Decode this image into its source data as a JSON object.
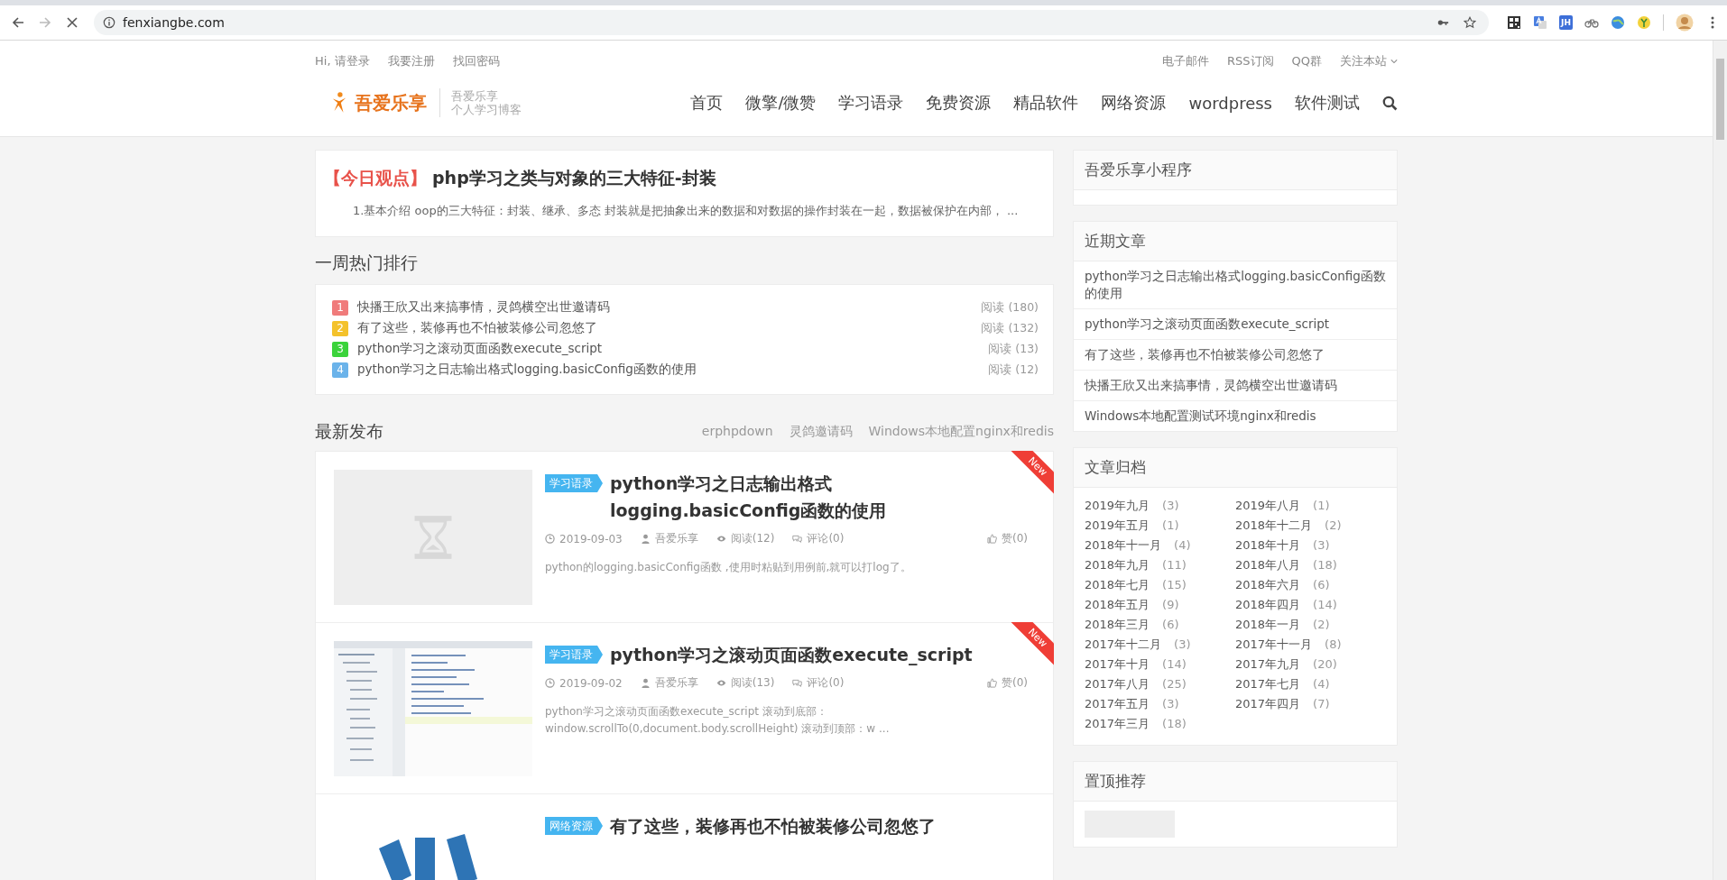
{
  "browser": {
    "url": "fenxiangbe.com",
    "loading": true,
    "extensions": [
      {
        "kind": "qr"
      },
      {
        "kind": "translate"
      },
      {
        "kind": "label",
        "label": "JH"
      },
      {
        "kind": "cloud"
      },
      {
        "kind": "globe"
      },
      {
        "kind": "badge"
      }
    ]
  },
  "header": {
    "top_left": [
      "Hi, 请登录",
      "我要注册",
      "找回密码"
    ],
    "top_right": [
      {
        "label": "电子邮件",
        "dropdown": false
      },
      {
        "label": "RSS订阅",
        "dropdown": false
      },
      {
        "label": "QQ群",
        "dropdown": false
      },
      {
        "label": "关注本站",
        "dropdown": true
      }
    ],
    "logo": {
      "name": "吾爱乐享",
      "tagline_1": "吾爱乐享",
      "tagline_2": "个人学习博客"
    },
    "nav": [
      "首页",
      "微擎/微赞",
      "学习语录",
      "免费资源",
      "精品软件",
      "网络资源",
      "wordpress",
      "软件测试"
    ]
  },
  "today": {
    "tag": "【今日观点】",
    "title": "php学习之类与对象的三大特征-封装",
    "excerpt": "1.基本介绍 oop的三大特征：封装、继承、多态 封装就是把抽象出来的数据和对数据的操作封装在一起，数据被保护在内部， ..."
  },
  "hot": {
    "title": "一周热门排行",
    "items": [
      {
        "rank": "1",
        "color": "#f07b7b",
        "title": "快播王欣又出来搞事情，灵鸽横空出世邀请码",
        "reads": "阅读 (180)"
      },
      {
        "rank": "2",
        "color": "#f4c22b",
        "title": "有了这些，装修再也不怕被装修公司忽悠了",
        "reads": "阅读 (132)"
      },
      {
        "rank": "3",
        "color": "#3bd33b",
        "title": "python学习之滚动页面函数execute_script",
        "reads": "阅读 (13)"
      },
      {
        "rank": "4",
        "color": "#6bb3ea",
        "title": "python学习之日志输出格式logging.basicConfig函数的使用",
        "reads": "阅读 (12)"
      }
    ]
  },
  "latest": {
    "title": "最新发布",
    "tags": [
      "erphpdown",
      "灵鸽邀请码",
      "Windows本地配置nginx和redis"
    ],
    "posts": [
      {
        "thumb": {
          "kind": "placeholder"
        },
        "category": "学习语录",
        "title": "python学习之日志输出格式logging.basicConfig函数的使用",
        "badge": "New",
        "date": "2019-09-03",
        "author": "吾爱乐享",
        "reads": "阅读(12)",
        "comments": "评论(0)",
        "likes": "赞(0)",
        "excerpt": "python的logging.basicConfig函数 ,使用时粘贴到用例前,就可以打log了。"
      },
      {
        "thumb": {
          "kind": "code"
        },
        "category": "学习语录",
        "title": "python学习之滚动页面函数execute_script",
        "badge": "New",
        "date": "2019-09-02",
        "author": "吾爱乐享",
        "reads": "阅读(13)",
        "comments": "评论(0)",
        "likes": "赞(0)",
        "excerpt": "python学习之滚动页面函数execute_script 滚动到底部：window.scrollTo(0,document.body.scrollHeight) 滚动到顶部：w ..."
      },
      {
        "thumb": {
          "kind": "logo"
        },
        "category": "网络资源",
        "title": "有了这些，装修再也不怕被装修公司忽悠了"
      }
    ]
  },
  "sidebar": [
    {
      "kind": "empty",
      "title": "吾爱乐享小程序"
    },
    {
      "kind": "list",
      "title": "近期文章",
      "items": [
        "python学习之日志输出格式logging.basicConfig函数的使用",
        "python学习之滚动页面函数execute_script",
        "有了这些，装修再也不怕被装修公司忽悠了",
        "快播王欣又出来搞事情，灵鸽横空出世邀请码",
        "Windows本地配置测试环境nginx和redis"
      ]
    },
    {
      "kind": "archive",
      "title": "文章归档",
      "items": [
        {
          "label": "2019年九月",
          "count": "(3)"
        },
        {
          "label": "2019年八月",
          "count": "(1)"
        },
        {
          "label": "2019年五月",
          "count": "(1)"
        },
        {
          "label": "2018年十二月",
          "count": "(2)"
        },
        {
          "label": "2018年十一月",
          "count": "(4)"
        },
        {
          "label": "2018年十月",
          "count": "(3)"
        },
        {
          "label": "2018年九月",
          "count": "(11)"
        },
        {
          "label": "2018年八月",
          "count": "(18)"
        },
        {
          "label": "2018年七月",
          "count": "(15)"
        },
        {
          "label": "2018年六月",
          "count": "(6)"
        },
        {
          "label": "2018年五月",
          "count": "(9)"
        },
        {
          "label": "2018年四月",
          "count": "(14)"
        },
        {
          "label": "2018年三月",
          "count": "(6)"
        },
        {
          "label": "2018年一月",
          "count": "(2)"
        },
        {
          "label": "2017年十二月",
          "count": "(3)"
        },
        {
          "label": "2017年十一月",
          "count": "(8)"
        },
        {
          "label": "2017年十月",
          "count": "(14)"
        },
        {
          "label": "2017年九月",
          "count": "(20)"
        },
        {
          "label": "2017年八月",
          "count": "(25)"
        },
        {
          "label": "2017年七月",
          "count": "(4)"
        },
        {
          "label": "2017年五月",
          "count": "(3)"
        },
        {
          "label": "2017年四月",
          "count": "(7)"
        },
        {
          "label": "2017年三月",
          "count": "(18)"
        }
      ]
    },
    {
      "kind": "featured",
      "title": "置顶推荐"
    }
  ]
}
